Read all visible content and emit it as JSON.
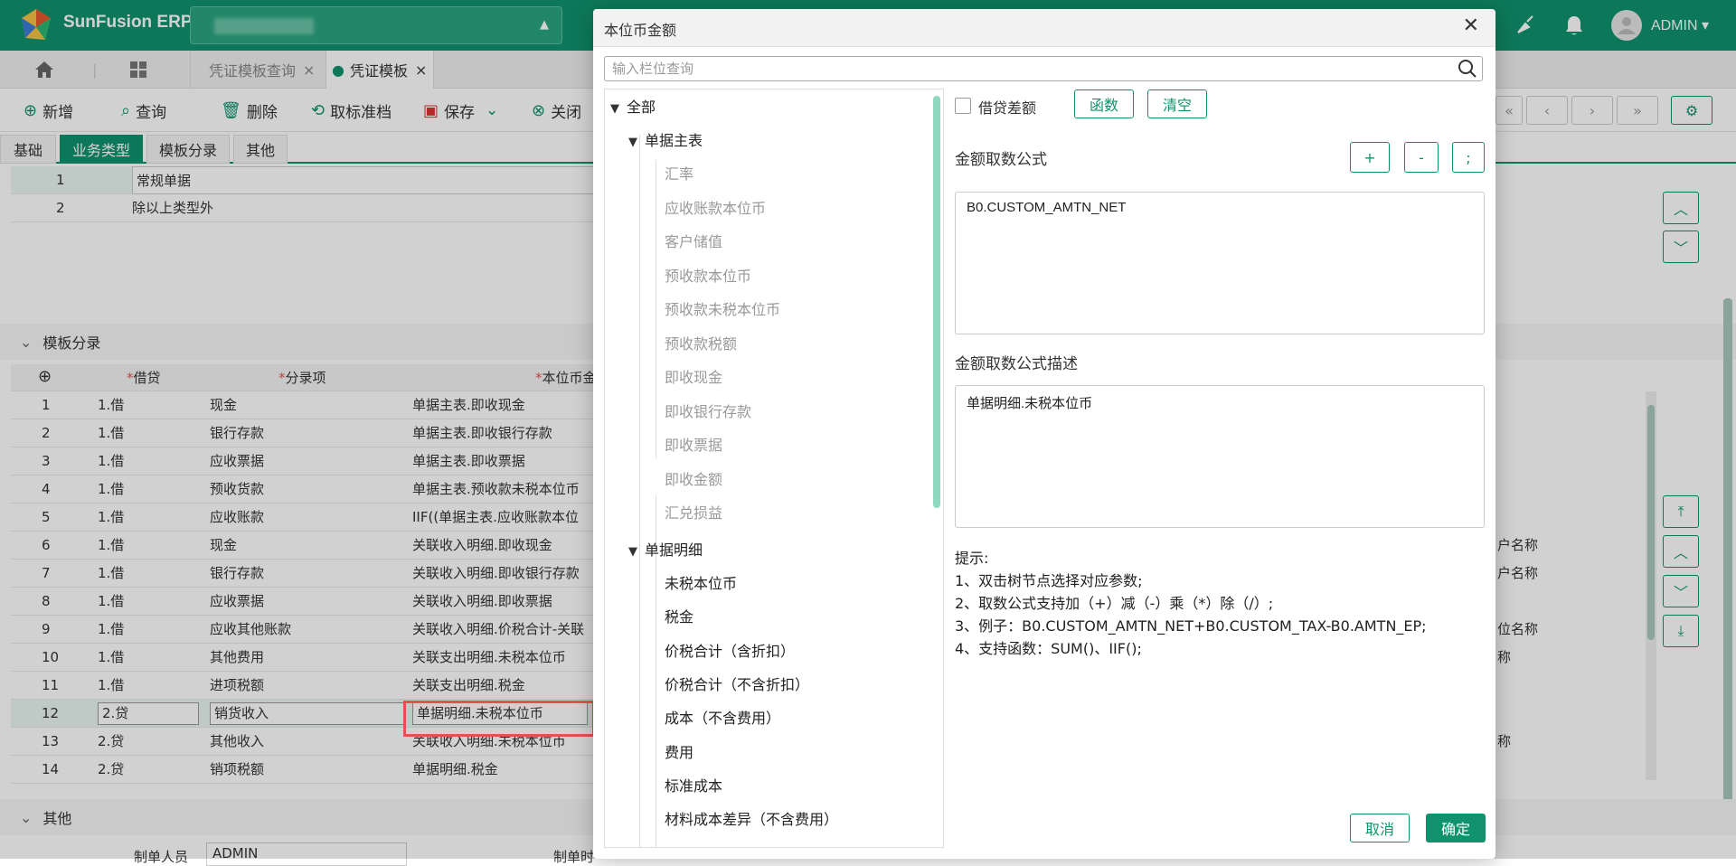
{
  "app": {
    "title": "SunFusion ERP",
    "user": "ADMIN"
  },
  "tabs": [
    "凭证模板查询",
    "凭证模板"
  ],
  "toolbar": {
    "add": "新增",
    "query": "查询",
    "delete": "删除",
    "cancel_std": "取标准档",
    "save": "保存",
    "close": "关闭"
  },
  "subtabs": [
    "基础",
    "业务类型",
    "模板分录",
    "其他"
  ],
  "biz_rows": [
    {
      "no": "1",
      "name": "常规单据"
    },
    {
      "no": "2",
      "name": "除以上类型外"
    }
  ],
  "sections": {
    "entries": "模板分录",
    "other": "其他"
  },
  "entries_headers": {
    "dc": "借贷",
    "item": "分录项",
    "amount": "本位币金"
  },
  "required_mark": "*",
  "entries": [
    {
      "no": "1",
      "dc": "1.借",
      "item": "现金",
      "amount": "单据主表.即收现金",
      "extra": ""
    },
    {
      "no": "2",
      "dc": "1.借",
      "item": "银行存款",
      "amount": "单据主表.即收银行存款",
      "extra": ""
    },
    {
      "no": "3",
      "dc": "1.借",
      "item": "应收票据",
      "amount": "单据主表.即收票据",
      "extra": ""
    },
    {
      "no": "4",
      "dc": "1.借",
      "item": "预收货款",
      "amount": "单据主表.预收款未税本位币",
      "extra": ""
    },
    {
      "no": "5",
      "dc": "1.借",
      "item": "应收账款",
      "amount": "IIF((单据主表.应收账款本位",
      "extra": ""
    },
    {
      "no": "6",
      "dc": "1.借",
      "item": "现金",
      "amount": "关联收入明细.即收现金",
      "extra": "户名称"
    },
    {
      "no": "7",
      "dc": "1.借",
      "item": "银行存款",
      "amount": "关联收入明细.即收银行存款",
      "extra": "户名称"
    },
    {
      "no": "8",
      "dc": "1.借",
      "item": "应收票据",
      "amount": "关联收入明细.即收票据",
      "extra": ""
    },
    {
      "no": "9",
      "dc": "1.借",
      "item": "应收其他账款",
      "amount": "关联收入明细.价税合计-关联",
      "extra": "位名称"
    },
    {
      "no": "10",
      "dc": "1.借",
      "item": "其他费用",
      "amount": "关联支出明细.未税本位币",
      "extra": "称"
    },
    {
      "no": "11",
      "dc": "1.借",
      "item": "进项税额",
      "amount": "关联支出明细.税金",
      "extra": ""
    },
    {
      "no": "12",
      "dc": "2.贷",
      "item": "销货收入",
      "amount": "单据明细.未税本位币",
      "extra": ""
    },
    {
      "no": "13",
      "dc": "2.贷",
      "item": "其他收入",
      "amount": "关联收入明细.未税本位币",
      "extra": "称"
    },
    {
      "no": "14",
      "dc": "2.贷",
      "item": "销项税额",
      "amount": "单据明细.税金",
      "extra": ""
    }
  ],
  "footer": {
    "maker_label": "制单人员",
    "maker_value": "ADMIN",
    "maker_date_label": "制单时"
  },
  "dialog": {
    "title": "本位币金额",
    "search_placeholder": "输入栏位查询",
    "tree_root": "全部",
    "tree_group1": "单据主表",
    "tree_group1_items": [
      "汇率",
      "应收账款本位币",
      "客户储值",
      "预收款本位币",
      "预收款未税本位币",
      "预收款税额",
      "即收现金",
      "即收银行存款",
      "即收票据",
      "即收金额",
      "汇兑损益"
    ],
    "tree_group2": "单据明细",
    "tree_group2_items": [
      "未税本位币",
      "税金",
      "价税合计（含折扣）",
      "价税合计（不含折扣）",
      "成本（不含费用）",
      "费用",
      "标准成本",
      "材料成本差异（不含费用）"
    ],
    "checkbox_label": "借贷差额",
    "btn_func": "函数",
    "btn_clear": "清空",
    "formula_label": "金额取数公式",
    "op_plus": "+",
    "op_minus": "-",
    "op_semicolon": ";",
    "formula_value": "B0.CUSTOM_AMTN_NET",
    "desc_label": "金额取数公式描述",
    "desc_value": "单据明细.未税本位币",
    "hints": [
      "提示:",
      "1、双击树节点选择对应参数;",
      "2、取数公式支持加（+）减（-）乘（*）除（/）;",
      "3、例子：B0.CUSTOM_AMTN_NET+B0.CUSTOM_TAX-B0.AMTN_EP;",
      "4、支持函数：SUM()、IIF();"
    ],
    "cancel": "取消",
    "ok": "确定"
  },
  "colors": {
    "brand": "#10936d",
    "annotation": "#e8504f"
  }
}
